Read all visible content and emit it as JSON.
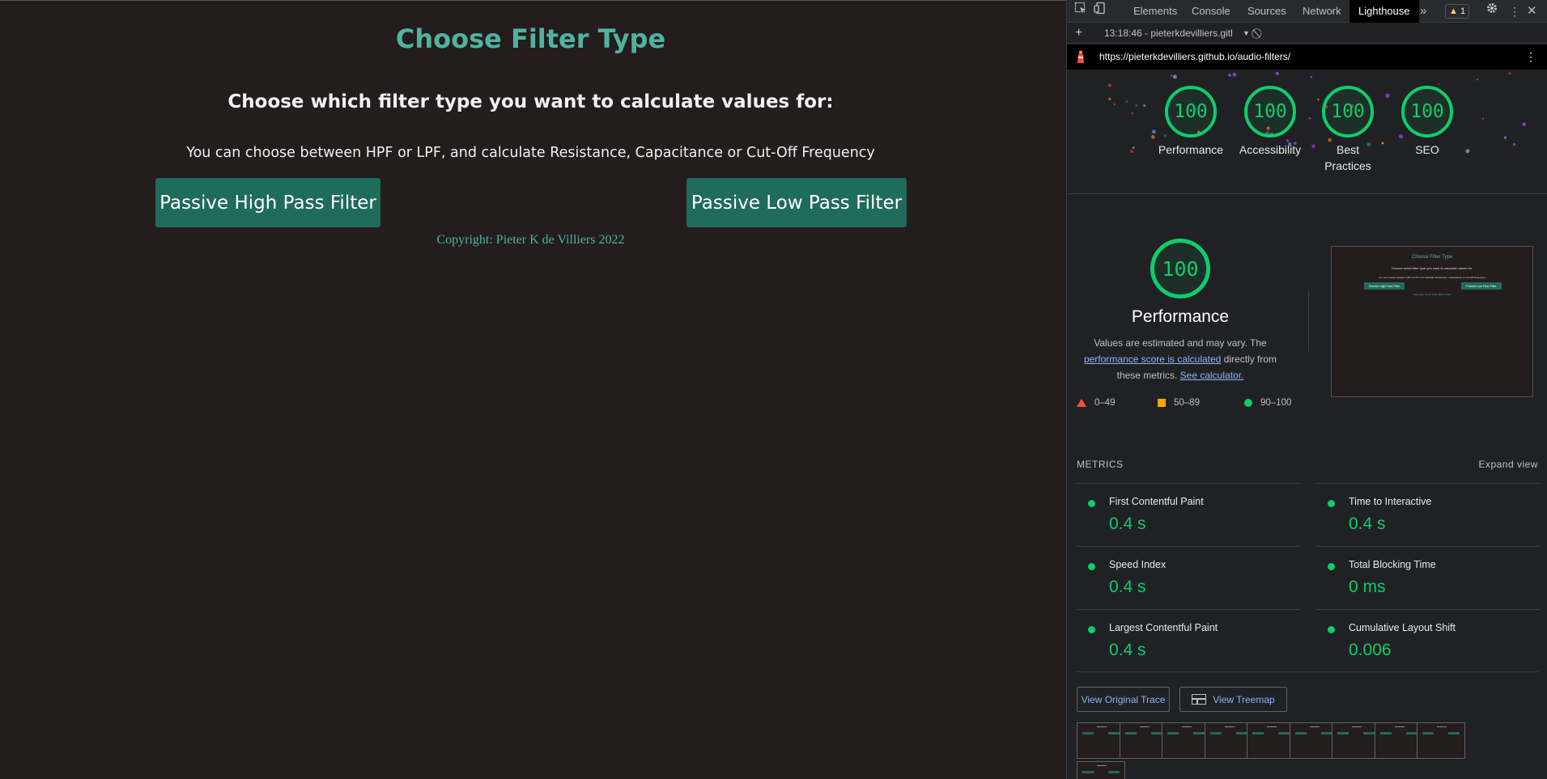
{
  "page": {
    "title": "Choose Filter Type",
    "subtitle": "Choose which filter type you want to calculate values for:",
    "description": "You can choose between HPF or LPF, and calculate Resistance, Capacitance or Cut-Off Frequency",
    "buttons": {
      "hpf": "Passive High Pass Filter",
      "lpf": "Passive Low Pass Filter"
    },
    "copyright": "Copyright: Pieter K de Villiers 2022"
  },
  "devtools": {
    "tabs": [
      "Elements",
      "Console",
      "Sources",
      "Network",
      "Lighthouse"
    ],
    "active_tab": "Lighthouse",
    "more_tabs_icon": "»",
    "warning_count": "1",
    "report_time": "13:18:46 - pieterkdevilliers.gitl",
    "report_url": "https://pieterkdevilliers.github.io/audio-filters/",
    "gauges": [
      {
        "score": "100",
        "label": "Performance"
      },
      {
        "score": "100",
        "label": "Accessibility"
      },
      {
        "score": "100",
        "label": "Best Practices"
      },
      {
        "score": "100",
        "label": "SEO"
      }
    ],
    "performance": {
      "score": "100",
      "title": "Performance",
      "desc_1": "Values are estimated and may vary. The",
      "desc_link_1": "performance score is calculated",
      "desc_2": "directly from these metrics.",
      "desc_link_2": "See calculator."
    },
    "legend": [
      {
        "shape": "triangle",
        "range": "0–49",
        "color": "#ff4e42"
      },
      {
        "shape": "square",
        "range": "50–89",
        "color": "#ffa400"
      },
      {
        "shape": "circle",
        "range": "90–100",
        "color": "#0cce6b"
      }
    ],
    "metrics_header": "METRICS",
    "expand_view": "Expand view",
    "metrics": [
      {
        "name": "First Contentful Paint",
        "value": "0.4 s"
      },
      {
        "name": "Time to Interactive",
        "value": "0.4 s"
      },
      {
        "name": "Speed Index",
        "value": "0.4 s"
      },
      {
        "name": "Total Blocking Time",
        "value": "0 ms"
      },
      {
        "name": "Largest Contentful Paint",
        "value": "0.4 s"
      },
      {
        "name": "Cumulative Layout Shift",
        "value": "0.006"
      }
    ],
    "view_trace": "View Original Trace",
    "view_treemap": "View Treemap"
  },
  "colors": {
    "page_bg": "#241c1d",
    "accent_teal": "#4fb3a0",
    "button_bg": "#1f6b5c",
    "pass_green": "#0cce6b",
    "link_blue": "#8ab4f8"
  }
}
